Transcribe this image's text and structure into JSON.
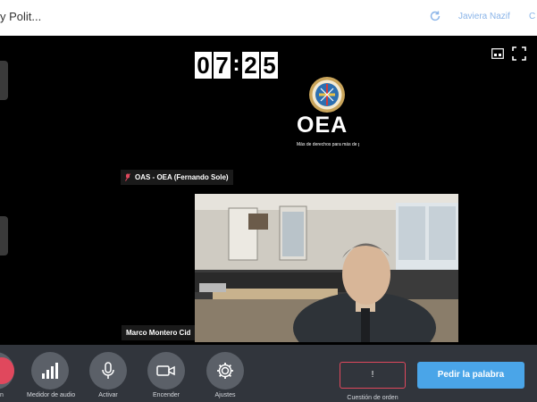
{
  "header": {
    "meeting_title": "y Polit...",
    "user_name": "Javiera Nazif",
    "user_extra": "C",
    "refresh_icon": "refresh-icon"
  },
  "tiles": {
    "main_top": {
      "counter_digits": [
        "0",
        "7",
        "2",
        "5"
      ],
      "counter_separator": ":",
      "logo_word": "OEA",
      "logo_slogan": "Más de derechos para más de personas",
      "participant_label": "OAS - OEA (Fernando Sole)",
      "muted_icon": "mic-off-icon"
    },
    "main_bottom": {
      "participant_label": "Marco Montero Cid"
    }
  },
  "toolbar": {
    "partial_label": "n",
    "tools": [
      {
        "label": "Medidor de audio",
        "icon": "audio-meter-icon"
      },
      {
        "label": "Activar",
        "icon": "microphone-icon"
      },
      {
        "label": "Encender",
        "icon": "camera-icon"
      },
      {
        "label": "Ajustes",
        "icon": "gear-icon"
      }
    ],
    "order_value": "!",
    "order_label": "Cuestión de orden",
    "ask_button_label": "Pedir la palabra"
  },
  "colors": {
    "accent_blue": "#4aa5e8",
    "alert_red": "#e0485d",
    "toolbar_bg": "#31353c",
    "tool_circle": "#5b6068"
  }
}
